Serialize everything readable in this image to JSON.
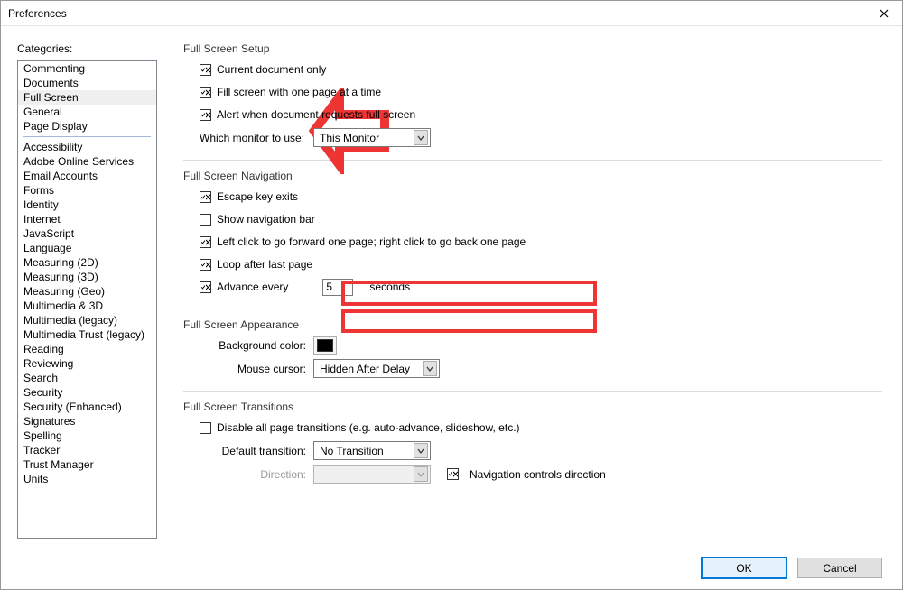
{
  "title": "Preferences",
  "categories_label": "Categories:",
  "categories_top": [
    "Commenting",
    "Documents",
    "Full Screen",
    "General",
    "Page Display"
  ],
  "categories_selected_index": 2,
  "categories_rest": [
    "Accessibility",
    "Adobe Online Services",
    "Email Accounts",
    "Forms",
    "Identity",
    "Internet",
    "JavaScript",
    "Language",
    "Measuring (2D)",
    "Measuring (3D)",
    "Measuring (Geo)",
    "Multimedia & 3D",
    "Multimedia (legacy)",
    "Multimedia Trust (legacy)",
    "Reading",
    "Reviewing",
    "Search",
    "Security",
    "Security (Enhanced)",
    "Signatures",
    "Spelling",
    "Tracker",
    "Trust Manager",
    "Units"
  ],
  "setup": {
    "title": "Full Screen Setup",
    "current_doc": "Current document only",
    "fill_screen": "Fill screen with one page at a time",
    "alert": "Alert when document requests full screen",
    "monitor_label": "Which monitor to use:",
    "monitor_value": "This Monitor"
  },
  "nav": {
    "title": "Full Screen Navigation",
    "escape": "Escape key exits",
    "show_nav": "Show navigation bar",
    "click_fwd": "Left click to go forward one page; right click to go back one page",
    "loop": "Loop after last page",
    "advance": "Advance every",
    "advance_value": "5",
    "seconds": "seconds"
  },
  "appearance": {
    "title": "Full Screen Appearance",
    "bgcolor_label": "Background color:",
    "bgcolor": "#000000",
    "cursor_label": "Mouse cursor:",
    "cursor_value": "Hidden After Delay"
  },
  "transitions": {
    "title": "Full Screen Transitions",
    "disable_all": "Disable all page transitions (e.g. auto-advance, slideshow, etc.)",
    "default_label": "Default transition:",
    "default_value": "No Transition",
    "direction_label": "Direction:",
    "direction_value": "",
    "nav_controls": "Navigation controls direction"
  },
  "buttons": {
    "ok": "OK",
    "cancel": "Cancel"
  },
  "highlight_color": "#ef3434"
}
